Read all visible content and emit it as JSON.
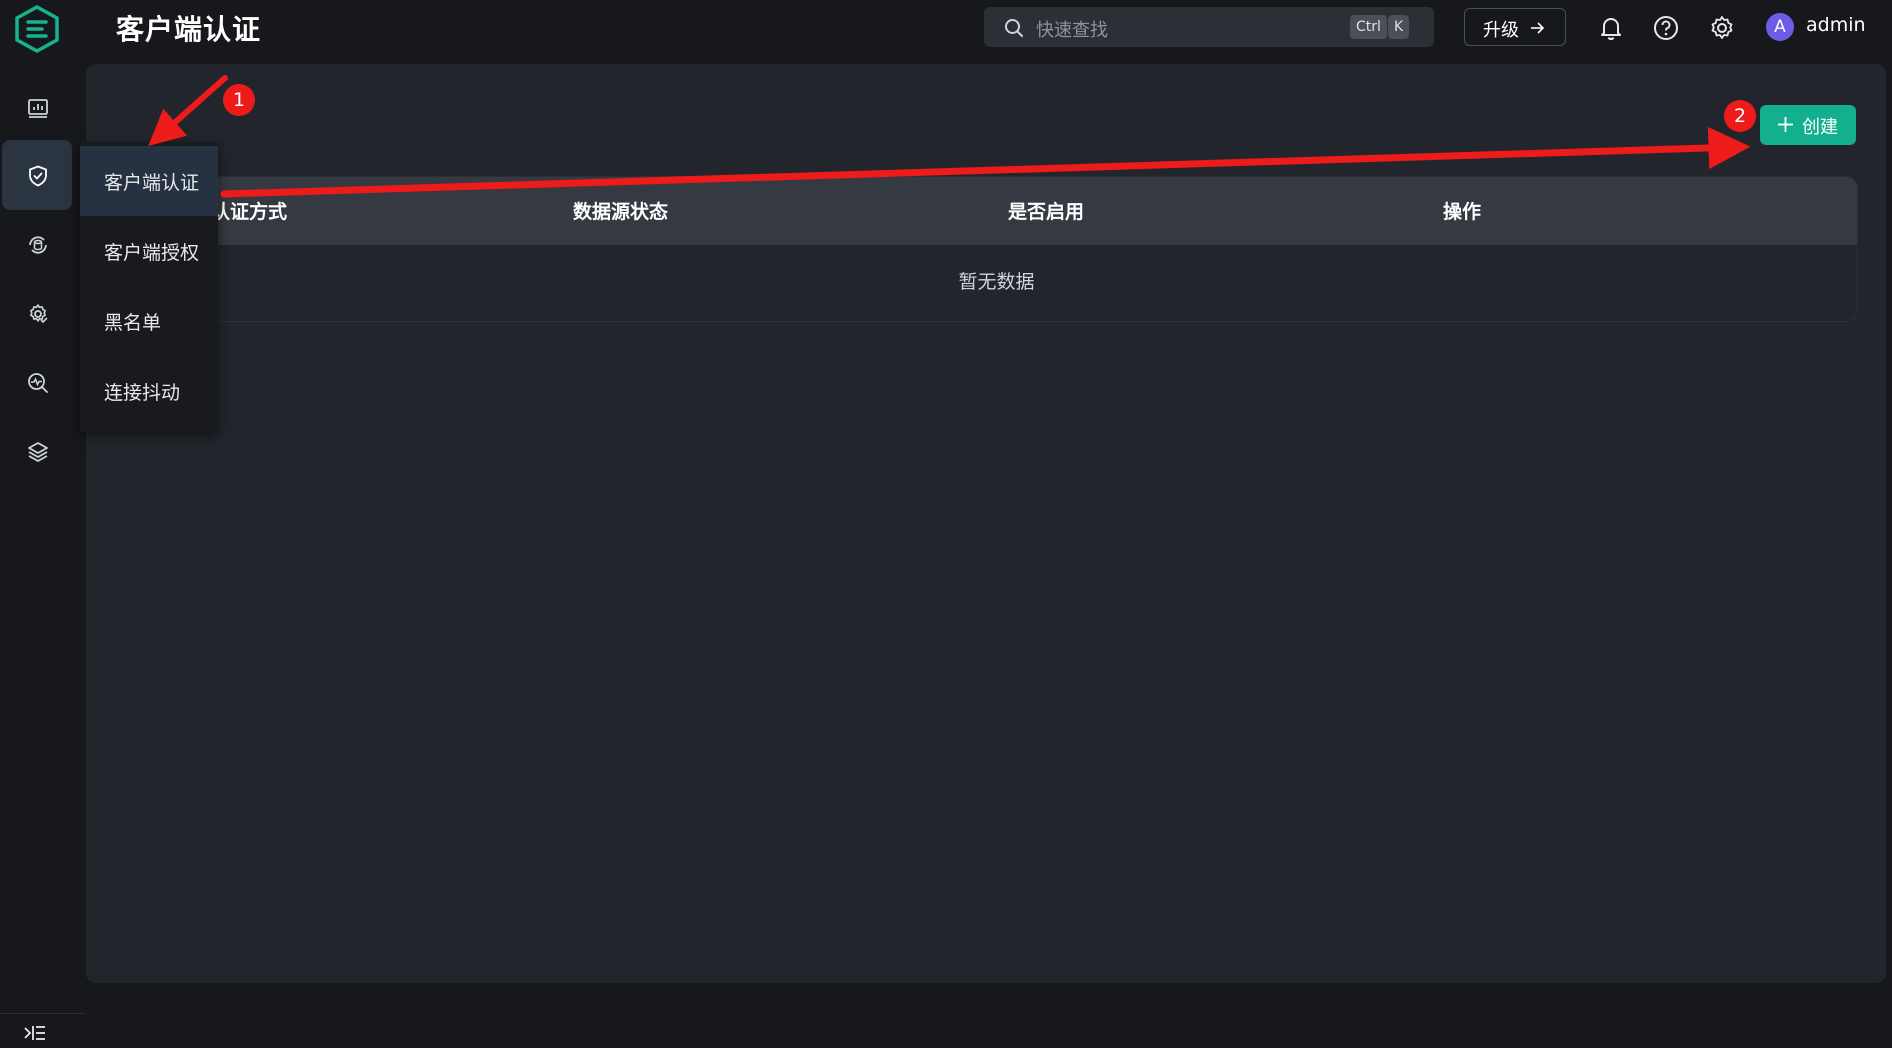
{
  "header": {
    "title": "客户端认证",
    "search_placeholder": "快速查找",
    "shortcut_ctrl": "Ctrl",
    "shortcut_k": "K",
    "upgrade_label": "升级",
    "user": {
      "avatar_letter": "A",
      "name": "admin"
    }
  },
  "rail": {
    "icons": [
      "dashboard-icon",
      "shield-check-icon",
      "sync-icon",
      "gear-check-icon",
      "monitor-search-icon",
      "layers-icon"
    ],
    "active_index": 1
  },
  "submenu": {
    "items": [
      "客户端认证",
      "客户端授权",
      "黑名单",
      "连接抖动"
    ],
    "active_index": 0
  },
  "main": {
    "create_label": "创建",
    "table": {
      "columns": [
        "认证方式",
        "数据源状态",
        "是否启用",
        "操作"
      ],
      "empty_text": "暂无数据"
    }
  },
  "annotations": {
    "badges": [
      "1",
      "2"
    ],
    "color": "#ee1b1b"
  },
  "colors": {
    "accent": "#13b08f",
    "avatar": "#6c5ce7",
    "active_bg": "#2b3441"
  }
}
